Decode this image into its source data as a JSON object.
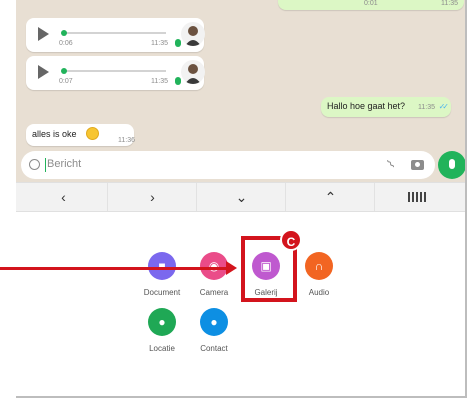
{
  "chat": {
    "top_bubble": {
      "duration": "0:01",
      "time": "11:35"
    },
    "voice_messages": [
      {
        "duration": "0:06",
        "time": "11:35"
      },
      {
        "duration": "0:07",
        "time": "11:35"
      }
    ],
    "outgoing": {
      "text": "Hallo hoe gaat het?",
      "time": "11:35"
    },
    "incoming": {
      "text": "alles is oke",
      "time": "11:36"
    }
  },
  "input": {
    "placeholder": "Bericht"
  },
  "keyboard_row": {
    "keys": [
      "‹",
      "›",
      "⌄",
      "⌃"
    ]
  },
  "attachments": [
    {
      "label": "Document",
      "color": "#7b68ee",
      "icon": "document-icon",
      "glyph": "■"
    },
    {
      "label": "Camera",
      "color": "#ea4c89",
      "icon": "camera-icon",
      "glyph": "◉"
    },
    {
      "label": "Galerij",
      "color": "#bf59cf",
      "icon": "gallery-icon",
      "glyph": "▣"
    },
    {
      "label": "Audio",
      "color": "#f26522",
      "icon": "headphones-icon",
      "glyph": "∩"
    },
    {
      "label": "Locatie",
      "color": "#1fa855",
      "icon": "location-icon",
      "glyph": "●"
    },
    {
      "label": "Contact",
      "color": "#0d8fe3",
      "icon": "contact-icon",
      "glyph": "●"
    }
  ],
  "annotation": {
    "badge": "C",
    "highlight_color": "#d3141d"
  }
}
